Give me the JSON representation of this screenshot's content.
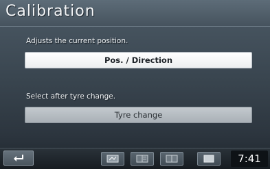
{
  "screen": {
    "title": "Calibration"
  },
  "sections": [
    {
      "label": "Adjusts the current position.",
      "button_label": "Pos. / Direction"
    },
    {
      "label": "Select after tyre change.",
      "button_label": "Tyre change"
    }
  ],
  "bottom_bar": {
    "back_icon": "return-icon",
    "view_buttons": [
      {
        "icon": "map-view-icon"
      },
      {
        "icon": "split-view-icon"
      },
      {
        "icon": "dual-map-view-icon"
      },
      {
        "icon": "monitor-view-icon"
      }
    ],
    "clock": "7:41"
  }
}
